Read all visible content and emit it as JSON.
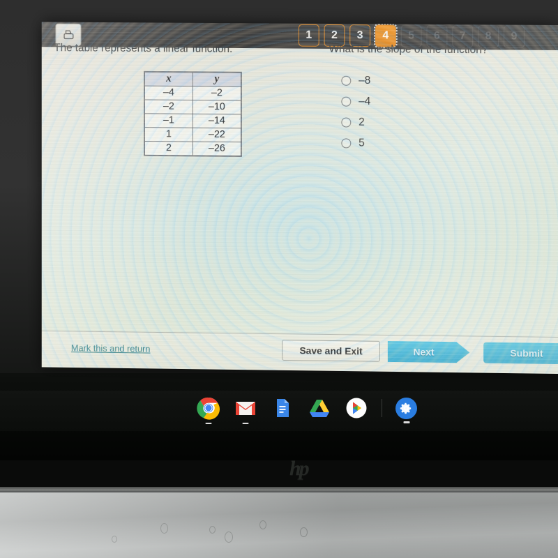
{
  "topbar": {
    "print_icon": "printer-icon",
    "pages": [
      {
        "label": "1",
        "state": "completed"
      },
      {
        "label": "2",
        "state": "completed"
      },
      {
        "label": "3",
        "state": "completed"
      },
      {
        "label": "4",
        "state": "current"
      },
      {
        "label": "5",
        "state": "locked"
      },
      {
        "label": "6",
        "state": "locked"
      },
      {
        "label": "7",
        "state": "locked"
      },
      {
        "label": "8",
        "state": "locked"
      },
      {
        "label": "9",
        "state": "locked"
      }
    ],
    "current_page": "4",
    "accent_color": "#e98a1e",
    "background_color": "#3a3a3a"
  },
  "question": {
    "stem": "The table represents a linear function.",
    "prompt": "What is the slope of the function?",
    "table": {
      "headers": [
        "x",
        "y"
      ],
      "rows": [
        [
          "–4",
          "–2"
        ],
        [
          "–2",
          "–10"
        ],
        [
          "–1",
          "–14"
        ],
        [
          "1",
          "–22"
        ],
        [
          "2",
          "–26"
        ]
      ]
    },
    "choices": [
      {
        "label": "–8",
        "selected": false
      },
      {
        "label": "–4",
        "selected": false
      },
      {
        "label": "2",
        "selected": false
      },
      {
        "label": "5",
        "selected": false
      }
    ]
  },
  "footer": {
    "mark_link": "Mark this and return",
    "save_exit": "Save and Exit",
    "next": "Next",
    "submit": "Submit",
    "button_color": "#36b0d2"
  },
  "shelf": {
    "apps": [
      {
        "name": "chrome-icon",
        "running": true
      },
      {
        "name": "gmail-icon",
        "running": true
      },
      {
        "name": "google-docs-icon",
        "running": false
      },
      {
        "name": "google-drive-icon",
        "running": false
      },
      {
        "name": "google-play-icon",
        "running": false
      },
      {
        "name": "settings-gear-icon",
        "running": true
      }
    ]
  },
  "device": {
    "brand": "hp"
  }
}
